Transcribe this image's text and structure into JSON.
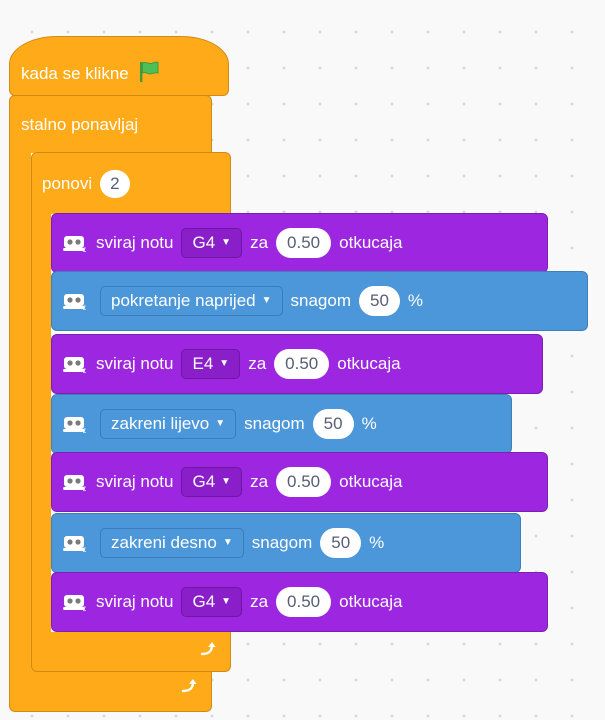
{
  "hat": {
    "label": "kada se klikne"
  },
  "forever": {
    "label": "stalno ponavljaj"
  },
  "repeat": {
    "label": "ponovi",
    "count": "2"
  },
  "blocks": [
    {
      "kind": "play_note",
      "label": "sviraj notu",
      "note": "G4",
      "for": "za",
      "beats": "0.50",
      "unit": "otkucaja"
    },
    {
      "kind": "motor",
      "action": "pokretanje naprijed",
      "power_label": "snagom",
      "power": "50",
      "unit": "%"
    },
    {
      "kind": "play_note",
      "label": "sviraj notu",
      "note": "E4",
      "for": "za",
      "beats": "0.50",
      "unit": "otkucaja"
    },
    {
      "kind": "motor",
      "action": "zakreni lijevo",
      "power_label": "snagom",
      "power": "50",
      "unit": "%"
    },
    {
      "kind": "play_note",
      "label": "sviraj notu",
      "note": "G4",
      "for": "za",
      "beats": "0.50",
      "unit": "otkucaja"
    },
    {
      "kind": "motor",
      "action": "zakreni desno",
      "power_label": "snagom",
      "power": "50",
      "unit": "%"
    },
    {
      "kind": "play_note",
      "label": "sviraj notu",
      "note": "G4",
      "for": "za",
      "beats": "0.50",
      "unit": "otkucaja"
    }
  ],
  "icons": {
    "flag": "green-flag-icon",
    "loop": "loop-arrow-icon",
    "extension": "robot-extension-icon"
  },
  "colors": {
    "events": "#ffab19",
    "control": "#ffab19",
    "music": "#9d26e0",
    "motor": "#4c97d9",
    "flag": "#4cbf56"
  }
}
